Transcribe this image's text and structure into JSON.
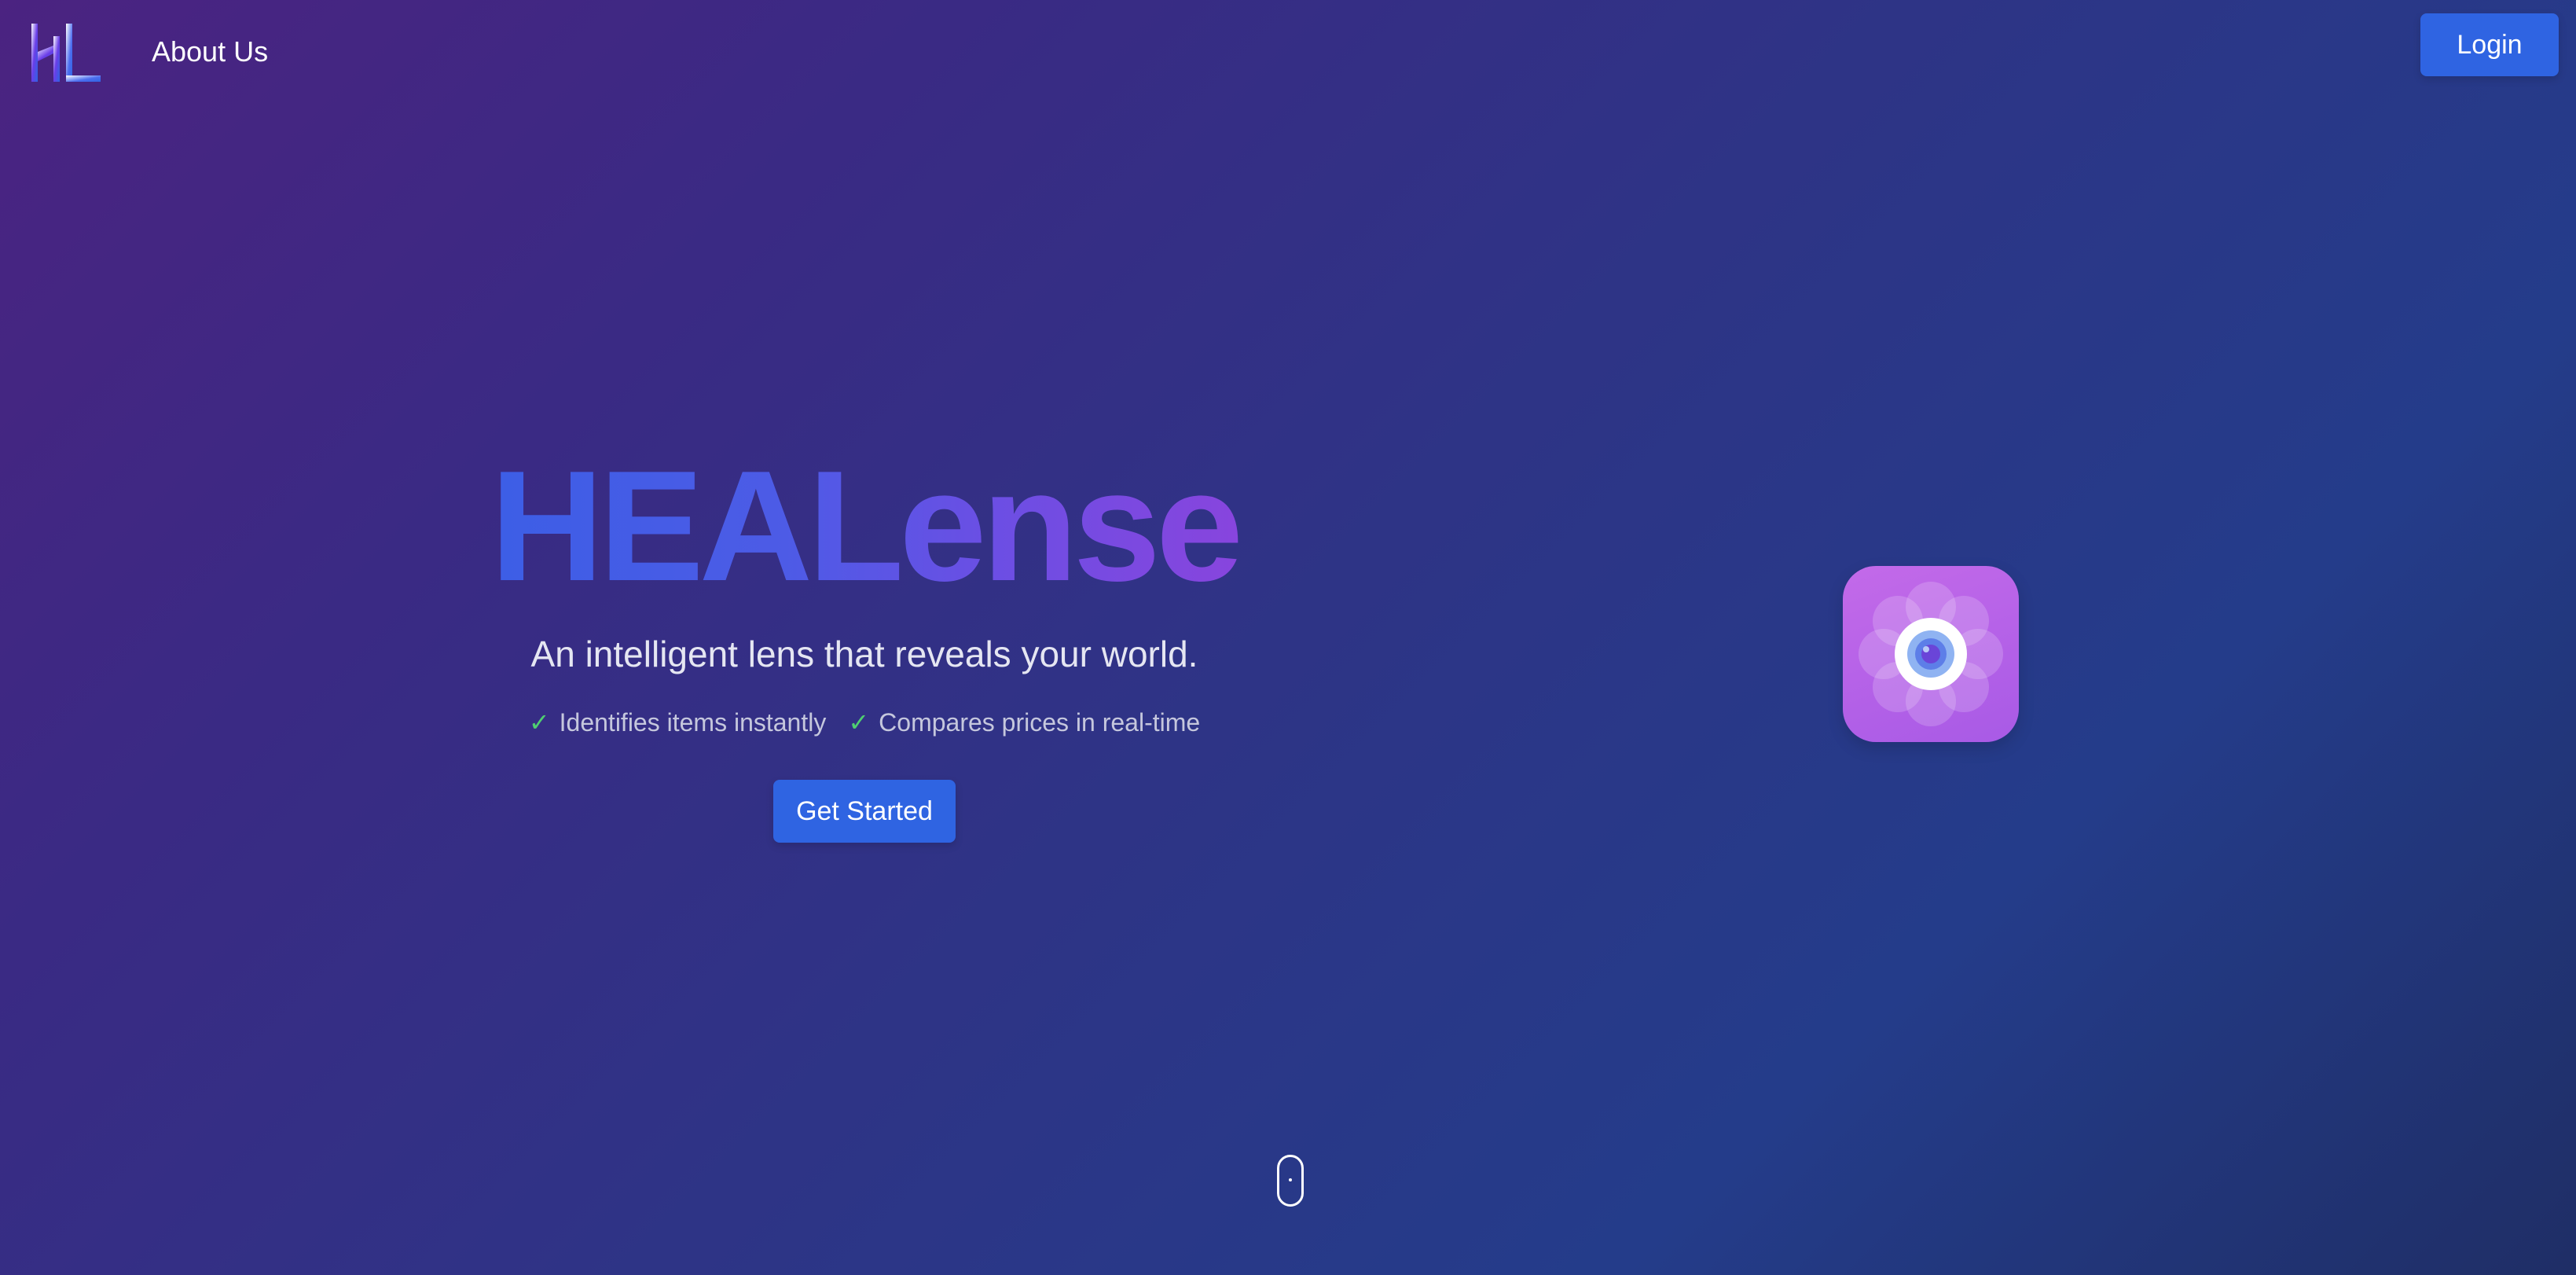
{
  "header": {
    "logo_icon": "hl-logo",
    "nav_about": "About Us",
    "login_label": "Login"
  },
  "hero": {
    "title": "HEALense",
    "subtitle": "An intelligent lens that reveals your world.",
    "features": [
      {
        "icon": "check-icon",
        "label": "Identifies items instantly"
      },
      {
        "icon": "check-icon",
        "label": "Compares prices in real-time"
      }
    ],
    "cta_label": "Get Started"
  },
  "app_icon": {
    "icon": "camera-lens-flower-icon"
  },
  "scroll": {
    "icon": "mouse-scroll-icon"
  },
  "colors": {
    "accent": "#2f64e2",
    "check": "#4fcf70"
  }
}
